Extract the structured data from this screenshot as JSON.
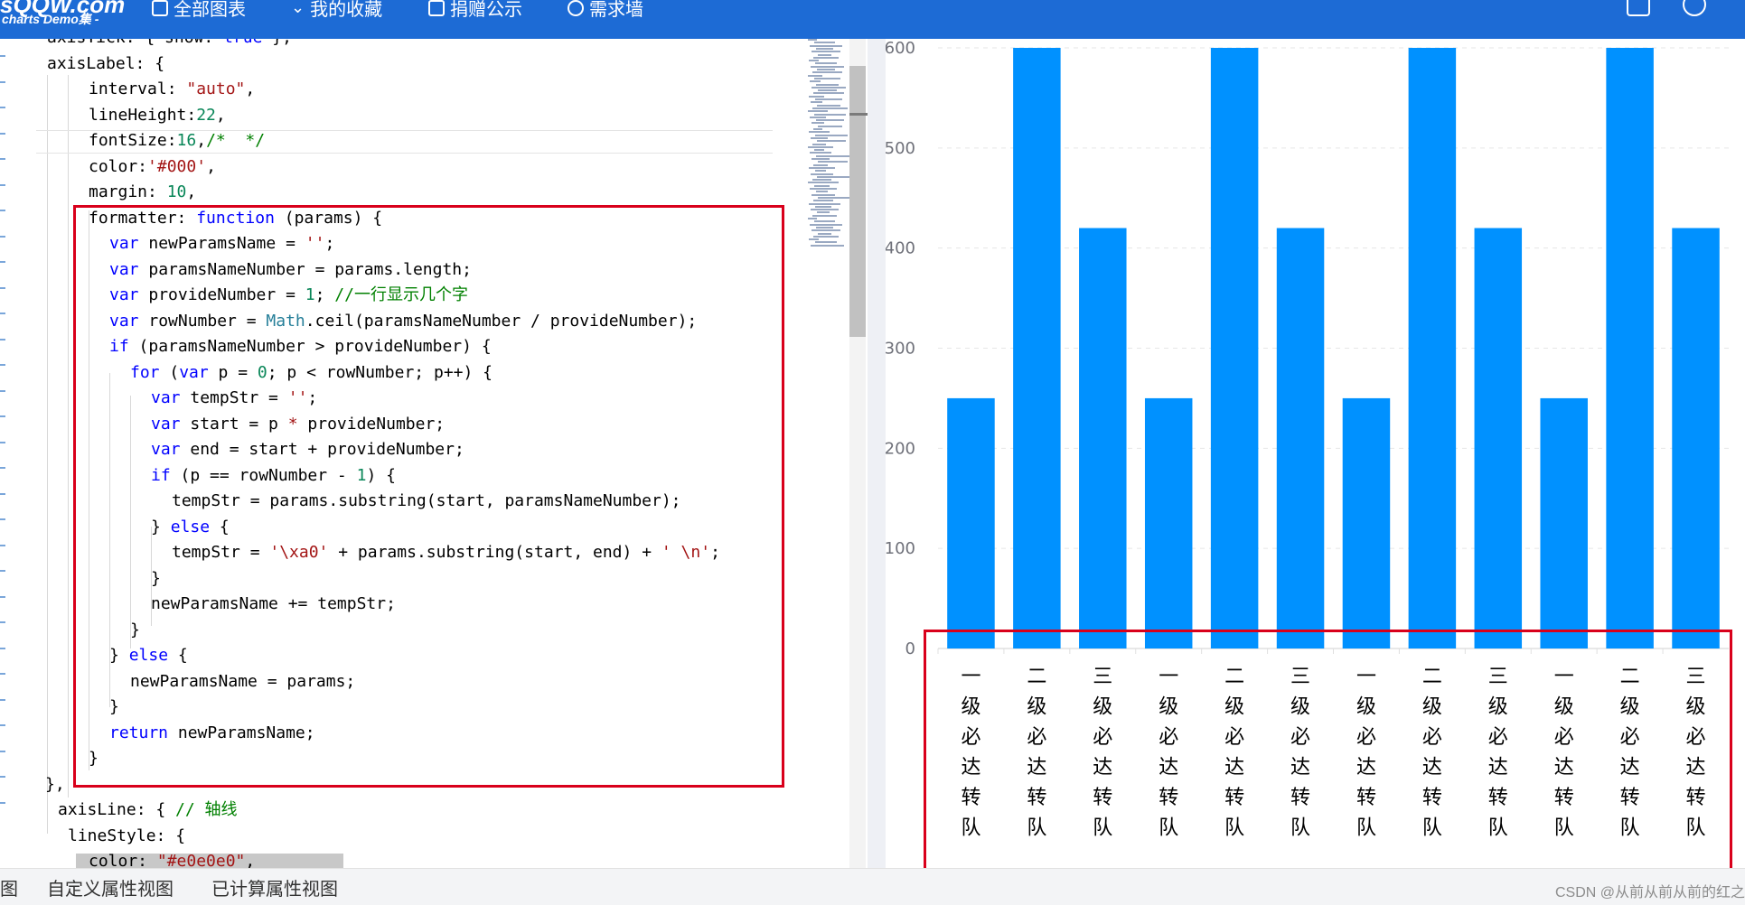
{
  "header": {
    "logo_line1": "sQQW.com",
    "logo_line2": "charts Demo集 -",
    "nav": [
      {
        "label": "全部图表",
        "icon": "grid-icon"
      },
      {
        "label": "我的收藏",
        "icon": "chevron-down-icon"
      },
      {
        "label": "捐赠公示",
        "icon": "gift-icon"
      },
      {
        "label": "需求墙",
        "icon": "circle-icon"
      }
    ]
  },
  "code_lines": [
    {
      "indent": 52,
      "tokens": [
        {
          "t": "axisTick: { show: ",
          "c": ""
        },
        {
          "t": "true",
          "c": "kw"
        },
        {
          "t": " },",
          "c": ""
        }
      ]
    },
    {
      "indent": 52,
      "tokens": [
        {
          "t": "axisLabel: {",
          "c": ""
        }
      ]
    },
    {
      "indent": 98,
      "tokens": [
        {
          "t": "interval: ",
          "c": ""
        },
        {
          "t": "\"auto\"",
          "c": "str"
        },
        {
          "t": ",",
          "c": ""
        }
      ]
    },
    {
      "indent": 98,
      "tokens": [
        {
          "t": "lineHeight:",
          "c": ""
        },
        {
          "t": "22",
          "c": "num"
        },
        {
          "t": ",",
          "c": ""
        }
      ]
    },
    {
      "indent": 98,
      "tokens": [
        {
          "t": "fontSize:",
          "c": ""
        },
        {
          "t": "16",
          "c": "num"
        },
        {
          "t": ",",
          "c": ""
        },
        {
          "t": "/*  */",
          "c": "cmt"
        }
      ]
    },
    {
      "indent": 98,
      "tokens": [
        {
          "t": "color:",
          "c": ""
        },
        {
          "t": "'#000'",
          "c": "str"
        },
        {
          "t": ",",
          "c": ""
        }
      ]
    },
    {
      "indent": 98,
      "tokens": [
        {
          "t": "margin: ",
          "c": ""
        },
        {
          "t": "10",
          "c": "num"
        },
        {
          "t": ",",
          "c": ""
        }
      ]
    },
    {
      "indent": 98,
      "tokens": [
        {
          "t": "formatter: ",
          "c": ""
        },
        {
          "t": "function",
          "c": "kw"
        },
        {
          "t": " (params) {",
          "c": ""
        }
      ]
    },
    {
      "indent": 121,
      "tokens": [
        {
          "t": "var",
          "c": "kw"
        },
        {
          "t": " newParamsName = ",
          "c": ""
        },
        {
          "t": "''",
          "c": "str"
        },
        {
          "t": ";",
          "c": ""
        }
      ]
    },
    {
      "indent": 121,
      "tokens": [
        {
          "t": "var",
          "c": "kw"
        },
        {
          "t": " paramsNameNumber = params.length;",
          "c": ""
        }
      ]
    },
    {
      "indent": 121,
      "tokens": [
        {
          "t": "var",
          "c": "kw"
        },
        {
          "t": " provideNumber = ",
          "c": ""
        },
        {
          "t": "1",
          "c": "num"
        },
        {
          "t": "; ",
          "c": ""
        },
        {
          "t": "//一行显示几个字",
          "c": "cmt"
        }
      ]
    },
    {
      "indent": 121,
      "tokens": [
        {
          "t": "var",
          "c": "kw"
        },
        {
          "t": " rowNumber = ",
          "c": ""
        },
        {
          "t": "Math",
          "c": "ty"
        },
        {
          "t": ".ceil(paramsNameNumber / provideNumber);",
          "c": ""
        }
      ]
    },
    {
      "indent": 121,
      "tokens": [
        {
          "t": "if",
          "c": "kw"
        },
        {
          "t": " (paramsNameNumber > provideNumber) {",
          "c": ""
        }
      ]
    },
    {
      "indent": 144,
      "tokens": [
        {
          "t": "for",
          "c": "kw"
        },
        {
          "t": " (",
          "c": ""
        },
        {
          "t": "var",
          "c": "kw"
        },
        {
          "t": " p = ",
          "c": ""
        },
        {
          "t": "0",
          "c": "num"
        },
        {
          "t": "; p < rowNumber; p++) {",
          "c": ""
        }
      ]
    },
    {
      "indent": 167,
      "tokens": [
        {
          "t": "var",
          "c": "kw"
        },
        {
          "t": " tempStr = ",
          "c": ""
        },
        {
          "t": "''",
          "c": "str"
        },
        {
          "t": ";",
          "c": ""
        }
      ]
    },
    {
      "indent": 167,
      "tokens": [
        {
          "t": "var",
          "c": "kw"
        },
        {
          "t": " start = p ",
          "c": ""
        },
        {
          "t": "*",
          "c": "str"
        },
        {
          "t": " provideNumber;",
          "c": ""
        }
      ]
    },
    {
      "indent": 167,
      "tokens": [
        {
          "t": "var",
          "c": "kw"
        },
        {
          "t": " end = start + provideNumber;",
          "c": ""
        }
      ]
    },
    {
      "indent": 167,
      "tokens": [
        {
          "t": "if",
          "c": "kw"
        },
        {
          "t": " (p == rowNumber - ",
          "c": ""
        },
        {
          "t": "1",
          "c": "num"
        },
        {
          "t": ") {",
          "c": ""
        }
      ]
    },
    {
      "indent": 190,
      "tokens": [
        {
          "t": "tempStr = params.substring(start, paramsNameNumber);",
          "c": ""
        }
      ]
    },
    {
      "indent": 167,
      "tokens": [
        {
          "t": "} ",
          "c": ""
        },
        {
          "t": "else",
          "c": "kw"
        },
        {
          "t": " {",
          "c": ""
        }
      ]
    },
    {
      "indent": 190,
      "tokens": [
        {
          "t": "tempStr = ",
          "c": ""
        },
        {
          "t": "'\\xa0'",
          "c": "str"
        },
        {
          "t": " + params.substring(start, end) + ",
          "c": ""
        },
        {
          "t": "' \\n'",
          "c": "str"
        },
        {
          "t": ";",
          "c": ""
        }
      ]
    },
    {
      "indent": 167,
      "tokens": [
        {
          "t": "}",
          "c": ""
        }
      ]
    },
    {
      "indent": 167,
      "tokens": [
        {
          "t": "newParamsName += tempStr;",
          "c": ""
        }
      ]
    },
    {
      "indent": 144,
      "tokens": [
        {
          "t": "}",
          "c": ""
        }
      ]
    },
    {
      "indent": 121,
      "tokens": [
        {
          "t": "} ",
          "c": ""
        },
        {
          "t": "else",
          "c": "kw"
        },
        {
          "t": " {",
          "c": ""
        }
      ]
    },
    {
      "indent": 144,
      "tokens": [
        {
          "t": "newParamsName = params;",
          "c": ""
        }
      ]
    },
    {
      "indent": 121,
      "tokens": [
        {
          "t": "}",
          "c": ""
        }
      ]
    },
    {
      "indent": 121,
      "tokens": [
        {
          "t": "return",
          "c": "kw"
        },
        {
          "t": " newParamsName;",
          "c": ""
        }
      ]
    },
    {
      "indent": 98,
      "tokens": [
        {
          "t": "}",
          "c": ""
        }
      ]
    },
    {
      "indent": 50,
      "tokens": [
        {
          "t": "},",
          "c": ""
        }
      ]
    },
    {
      "indent": 64,
      "tokens": [
        {
          "t": "axisLine: { ",
          "c": ""
        },
        {
          "t": "// 轴线",
          "c": "cmt"
        }
      ]
    },
    {
      "indent": 75,
      "tokens": [
        {
          "t": "lineStyle: {",
          "c": ""
        }
      ]
    },
    {
      "indent": 98,
      "tokens": [
        {
          "t": "color: ",
          "c": ""
        },
        {
          "t": "\"#e0e0e0\"",
          "c": "str"
        },
        {
          "t": ",",
          "c": ""
        }
      ]
    }
  ],
  "chart_data": {
    "type": "bar",
    "categories": [
      "一级必达转队",
      "二级必达转队",
      "三级必达转队",
      "一级必达转队",
      "二级必达转队",
      "三级必达转队",
      "一级必达转队",
      "二级必达转队",
      "三级必达转队",
      "一级必达转队",
      "二级必达转队",
      "三级必达转队"
    ],
    "values": [
      250,
      600,
      420,
      250,
      600,
      420,
      250,
      600,
      420,
      250,
      600,
      420
    ],
    "yticks": [
      0,
      100,
      200,
      300,
      400,
      500,
      600
    ],
    "ylim": [
      0,
      600
    ],
    "grid": true,
    "bar_color": "#0091ff",
    "title": "",
    "xlabel": "",
    "ylabel": ""
  },
  "bottom_tabs": [
    "图",
    "自定义属性视图",
    "已计算属性视图"
  ],
  "watermark": "CSDN @从前从前从前的红之"
}
